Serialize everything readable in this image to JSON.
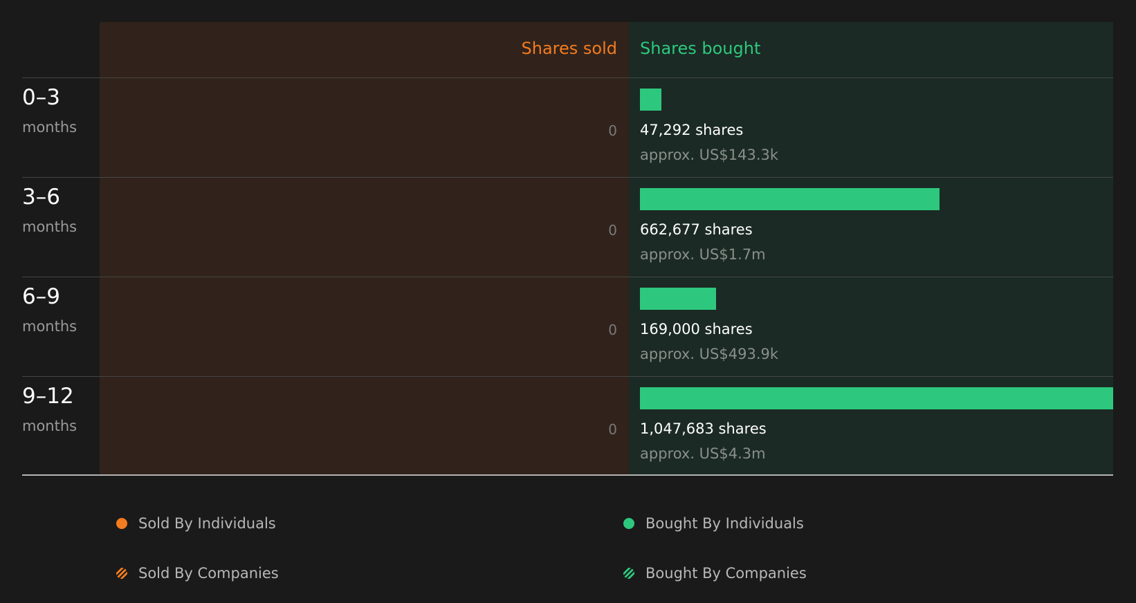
{
  "colors": {
    "sold": "#f47b20",
    "bought": "#2dc87e",
    "sold_panel": "#31231b",
    "bought_panel": "#1b2a24"
  },
  "chart_data": {
    "type": "bar",
    "orientation": "horizontal",
    "headers": {
      "sold": "Shares sold",
      "bought": "Shares bought"
    },
    "categories": [
      "0–3",
      "3–6",
      "6–9",
      "9–12"
    ],
    "unit_label": "months",
    "sold_values": [
      0,
      0,
      0,
      0
    ],
    "sold_labels": [
      "0",
      "0",
      "0",
      "0"
    ],
    "bought_values": [
      47292,
      662677,
      169000,
      1047683
    ],
    "bought_labels": [
      "47,292 shares",
      "662,677 shares",
      "169,000 shares",
      "1,047,683 shares"
    ],
    "bought_approx": [
      "approx. US$143.3k",
      "approx. US$1.7m",
      "approx. US$493.9k",
      "approx. US$4.3m"
    ],
    "legend": [
      {
        "label": "Sold By Individuals",
        "color": "#f47b20",
        "style": "solid"
      },
      {
        "label": "Bought By Individuals",
        "color": "#2dc87e",
        "style": "solid"
      },
      {
        "label": "Sold By Companies",
        "color": "#f47b20",
        "style": "hatched"
      },
      {
        "label": "Bought By Companies",
        "color": "#2dc87e",
        "style": "hatched"
      }
    ]
  }
}
